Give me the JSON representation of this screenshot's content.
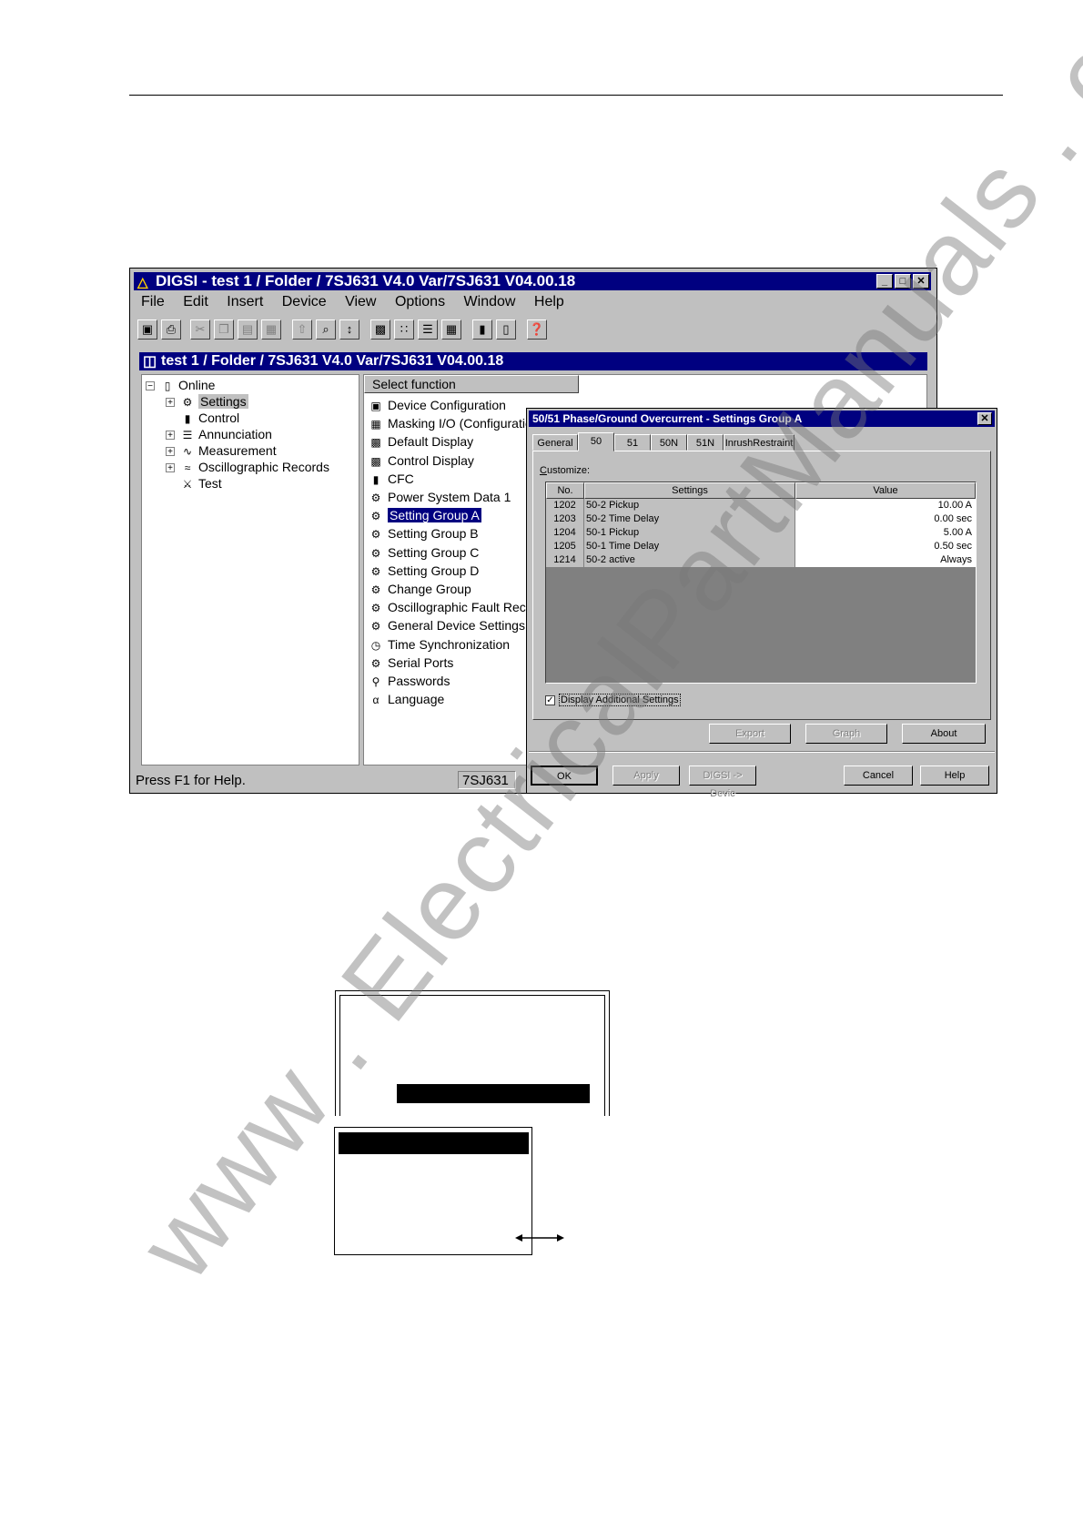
{
  "app": {
    "title": "DIGSI - test 1 / Folder / 7SJ631 V4.0 Var/7SJ631 V04.00.18",
    "menu": [
      "File",
      "Edit",
      "Insert",
      "Device",
      "View",
      "Options",
      "Window",
      "Help"
    ],
    "mdi_title": "test 1 / Folder / 7SJ631 V4.0 Var/7SJ631 V04.00.18",
    "tree": {
      "root": "Online",
      "items": [
        "Settings",
        "Control",
        "Annunciation",
        "Measurement",
        "Oscillographic Records",
        "Test"
      ]
    },
    "functions": {
      "header": "Select function",
      "items": [
        "Device Configuration",
        "Masking I/O (Configuratic",
        "Default Display",
        "Control Display",
        "CFC",
        "Power System Data 1",
        "Setting Group A",
        "Setting Group B",
        "Setting Group C",
        "Setting Group D",
        "Change Group",
        "Oscillographic Fault Recc",
        "General Device Settings",
        "Time Synchronization",
        "Serial Ports",
        "Passwords",
        "Language"
      ],
      "selected_index": 6
    },
    "status": {
      "message": "Press F1 for Help.",
      "device": "7SJ631"
    }
  },
  "dialog": {
    "title": "50/51 Phase/Ground Overcurrent - Settings Group A",
    "tabs": [
      "General",
      "50",
      "51",
      "50N",
      "51N",
      "InrushRestraint"
    ],
    "active_tab": "50",
    "customize_label": "Customize:",
    "columns": [
      "No.",
      "Settings",
      "Value"
    ],
    "rows": [
      {
        "no": "1202",
        "setting": "50-2 Pickup",
        "value": "10.00 A"
      },
      {
        "no": "1203",
        "setting": "50-2 Time Delay",
        "value": "0.00 sec"
      },
      {
        "no": "1204",
        "setting": "50-1 Pickup",
        "value": "5.00 A"
      },
      {
        "no": "1205",
        "setting": "50-1 Time Delay",
        "value": "0.50 sec"
      },
      {
        "no": "1214",
        "setting": "50-2 active",
        "value": "Always"
      }
    ],
    "checkbox": {
      "label": "Display Additional Settings",
      "checked": true
    },
    "buttons": {
      "export": "Export",
      "graph": "Graph",
      "about": "About",
      "ok": "OK",
      "apply": "Apply",
      "digsi_device": "DIGSI -> Devic",
      "cancel": "Cancel",
      "help": "Help"
    }
  },
  "watermark": "www . ElectricalPartManuals . com",
  "colors": {
    "titlebar": "#000080",
    "face": "#c0c0c0",
    "grid_bg": "#808080"
  }
}
